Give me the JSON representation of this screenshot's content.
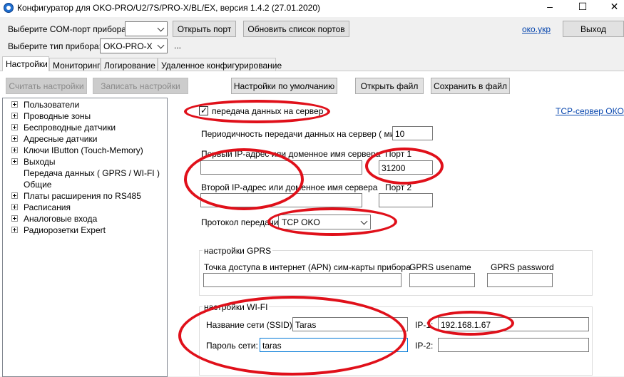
{
  "window": {
    "title": "Конфигуратор для OKO-PRO/U2/7S/PRO-X/BL/EX, версия 1.4.2 (27.01.2020)",
    "icon": "app-icon",
    "controls": {
      "minimize": "–",
      "maximize": "☐",
      "close": "✕"
    }
  },
  "top": {
    "com_label": "Выберите COM-порт прибора:",
    "com_value": "",
    "open_port": "Открыть порт",
    "refresh_ports": "Обновить список портов",
    "device_label": "Выберите тип прибора:",
    "device_value": "OKO-PRO-X",
    "ellipsis": "...",
    "site_link": "око.укр",
    "exit": "Выход"
  },
  "tabs": [
    "Настройки",
    "Мониторинг",
    "Логирование",
    "Удаленное конфигурирование"
  ],
  "toolbar": {
    "read": "Считать настройки",
    "write": "Записать настройки",
    "defaults": "Настройки по умолчанию",
    "open_file": "Открыть файл",
    "save_file": "Сохранить в файл"
  },
  "tree": [
    {
      "label": "Пользователи",
      "expand": true
    },
    {
      "label": "Проводные зоны",
      "expand": true
    },
    {
      "label": "Беспроводные датчики",
      "expand": true
    },
    {
      "label": "Адресные датчики",
      "expand": true
    },
    {
      "label": "Ключи IButton (Touch-Memory)",
      "expand": true
    },
    {
      "label": "Выходы",
      "expand": true
    },
    {
      "label": "Передача данных ( GPRS / WI-FI )",
      "expand": false
    },
    {
      "label": "Общие",
      "expand": false
    },
    {
      "label": "Платы расширения по RS485",
      "expand": true
    },
    {
      "label": "Расписания",
      "expand": true
    },
    {
      "label": "Аналоговые входа",
      "expand": true
    },
    {
      "label": "Радиорозетки Expert",
      "expand": true
    }
  ],
  "panel": {
    "send_label": "передача данных на сервер",
    "send_checked": "✓",
    "tcp_link": "TCP-сервер ОКО",
    "period_label": "Периодичность передачи данных на сервер ( мин ):",
    "period_value": "10",
    "ip1_label": "Первый IP-адрес или доменное имя сервера",
    "ip1_value": "",
    "port1_label": "Порт 1",
    "port1_value": "31200",
    "ip2_label": "Второй IP-адрес или доменное имя сервера",
    "ip2_value": "",
    "port2_label": "Порт 2",
    "port2_value": "",
    "protocol_label": "Протокол передачи:",
    "protocol_value": "TCP OKO",
    "gprs_group": "настройки GPRS",
    "apn_label": "Точка доступа в интернет (APN) сим-карты прибора",
    "apn_value": "",
    "gprs_user_label": "GPRS usename",
    "gprs_user_value": "",
    "gprs_pass_label": "GPRS password",
    "gprs_pass_value": "",
    "wifi_group": "настройки WI-FI",
    "ssid_label": "Название сети (SSID):",
    "ssid_value": "Taras",
    "pass_label": "Пароль сети:",
    "pass_value": "taras",
    "ip1w_label": "IP-1:",
    "ip1w_value": "192.168.1.67",
    "ip2w_label": "IP-2:",
    "ip2w_value": ""
  },
  "colors": {
    "annotation": "#e0101a",
    "link": "#0645ad",
    "focus": "#0078d7"
  }
}
